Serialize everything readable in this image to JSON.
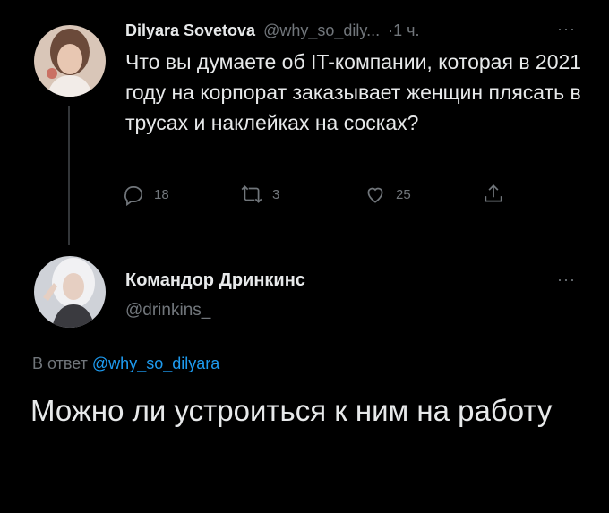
{
  "colors": {
    "background": "#000000",
    "text": "#e7e9ea",
    "muted": "#71767b",
    "link": "#1d9bf0",
    "thread_line": "#333639"
  },
  "parent_tweet": {
    "author_name": "Dilyara Sovetova",
    "author_handle": "@why_so_dily...",
    "time": "·1 ч.",
    "more_label": "···",
    "text": "Что вы думаете об IT-компании, которая в 2021 году на корпорат заказывает женщин плясать в трусах и наклейках на сосках?",
    "actions": {
      "replies": "18",
      "retweets": "3",
      "likes": "25"
    },
    "icons": [
      "reply-icon",
      "retweet-icon",
      "like-icon",
      "share-icon"
    ]
  },
  "reply_tweet": {
    "author_name": "Командор Дринкинс",
    "author_handle": "@drinkins_",
    "more_label": "···",
    "reply_prefix": "В ответ",
    "reply_to_handle": "@why_so_dilyara",
    "text": "Можно ли устроиться к ним на работу"
  }
}
